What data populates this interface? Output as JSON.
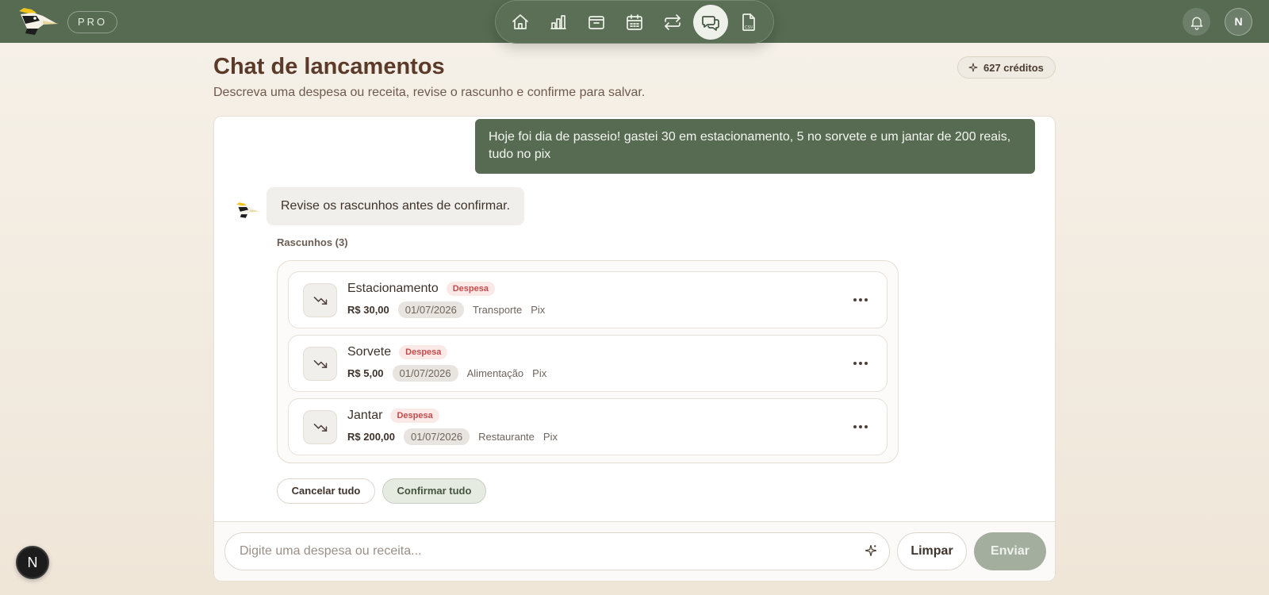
{
  "topbar": {
    "pro_label": "PRO",
    "avatar_initial": "N",
    "nav_items": [
      {
        "icon": "home-icon",
        "active": false
      },
      {
        "icon": "bar-chart-icon",
        "active": false
      },
      {
        "icon": "wallet-icon",
        "active": false
      },
      {
        "icon": "calendar-icon",
        "active": false
      },
      {
        "icon": "transfer-arrows-icon",
        "active": false
      },
      {
        "icon": "chat-icon",
        "active": true
      },
      {
        "icon": "csv-file-icon",
        "active": false
      }
    ],
    "csv_label": "CSV"
  },
  "header": {
    "title": "Chat de lancamentos",
    "subtitle": "Descreva uma despesa ou receita, revise o rascunho e confirme para salvar.",
    "credits": "627 créditos"
  },
  "chat": {
    "user_message": "Hoje foi dia de passeio! gastei 30 em estacionamento, 5 no sorvete e um jantar de 200 reais, tudo no pix",
    "bot_message": "Revise os rascunhos antes de confirmar.",
    "drafts_label": "Rascunhos (3)",
    "drafts": [
      {
        "name": "Estacionamento",
        "type": "Despesa",
        "amount": "R$ 30,00",
        "date": "01/07/2026",
        "category": "Transporte",
        "method": "Pix"
      },
      {
        "name": "Sorvete",
        "type": "Despesa",
        "amount": "R$ 5,00",
        "date": "01/07/2026",
        "category": "Alimentação",
        "method": "Pix"
      },
      {
        "name": "Jantar",
        "type": "Despesa",
        "amount": "R$ 200,00",
        "date": "01/07/2026",
        "category": "Restaurante",
        "method": "Pix"
      }
    ],
    "cancel_all": "Cancelar tudo",
    "confirm_all": "Confirmar tudo"
  },
  "composer": {
    "placeholder": "Digite uma despesa ou receita...",
    "value": "",
    "clear_label": "Limpar",
    "send_label": "Enviar"
  },
  "floating": {
    "label": "N"
  },
  "colors": {
    "topbar": "#566b52",
    "user_bubble": "#566b52",
    "title": "#5b3a29",
    "expense_tag": "#c44b4b",
    "send_disabled": "#a3ae9e"
  }
}
